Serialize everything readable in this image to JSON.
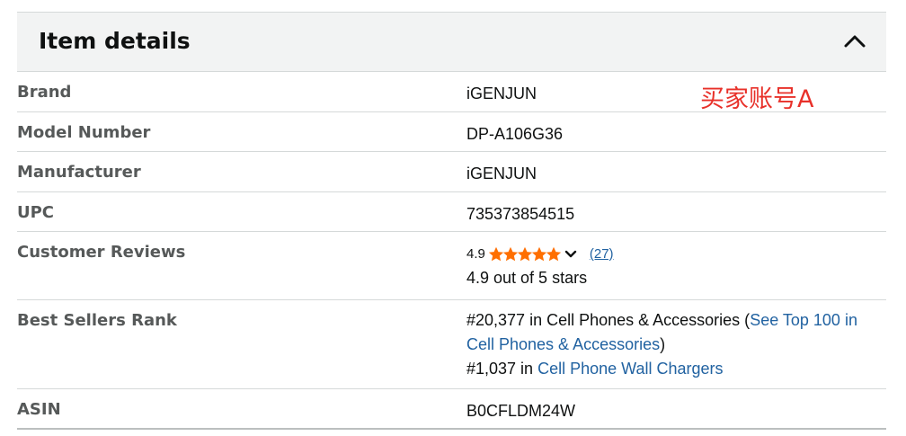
{
  "panel": {
    "title": "Item details"
  },
  "rows": [
    {
      "label": "Brand",
      "value": "iGENJUN"
    },
    {
      "label": "Model Number",
      "value": "DP-A106G36"
    },
    {
      "label": "Manufacturer",
      "value": "iGENJUN"
    },
    {
      "label": "UPC",
      "value": "735373854515"
    },
    {
      "label": "Customer Reviews"
    },
    {
      "label": "Best Sellers Rank"
    },
    {
      "label": "ASIN",
      "value": "B0CFLDM24W"
    }
  ],
  "reviews": {
    "rating": "4.9",
    "stars_filled": 4.9,
    "count": "(27)",
    "summary": "4.9 out of 5 stars",
    "star_color": "#ff6f00"
  },
  "rank": {
    "line1_text": "#20,377 in Cell Phones & Accessories (",
    "line1_link": "See Top 100 in Cell Phones & Accessories",
    "line1_close": ")",
    "line2_text": "#1,037 in ",
    "line2_link": "Cell Phone Wall Chargers"
  },
  "watermark": "买家账号A",
  "colors": {
    "link": "#2162a1",
    "header_bg": "#f2f3f3",
    "divider": "#d5d9d9",
    "watermark": "#e8312a"
  }
}
